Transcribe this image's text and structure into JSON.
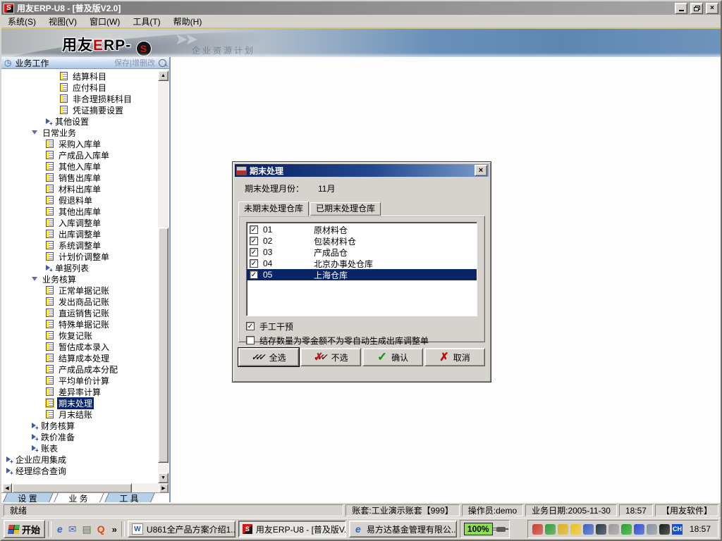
{
  "colors": {
    "selection": "#0a246a",
    "chrome": "#d6d3ce",
    "dialog_title_start": "#081f5e",
    "dialog_title_end": "#7c9dca",
    "brand_red": "#cc0000",
    "battery_green": "#8ce04c"
  },
  "window": {
    "title": "用友ERP-U8 - [普及版V2.0]",
    "logo_letter": "S"
  },
  "menu": {
    "items": [
      "系统(S)",
      "视图(V)",
      "窗口(W)",
      "工具(T)",
      "帮助(H)"
    ]
  },
  "banner": {
    "logo": {
      "brand": "用友",
      "e": "E",
      "rp": "RP",
      "dash": "-",
      "u8": "S"
    },
    "watermark": "企业资源计划"
  },
  "sidebar": {
    "header": {
      "title": "业务工作",
      "actions": "保存|增删改"
    },
    "tree": [
      {
        "label": "结算科目",
        "level": 3,
        "icon": "doc"
      },
      {
        "label": "应付科目",
        "level": 3,
        "icon": "doc"
      },
      {
        "label": "非合理损耗科目",
        "level": 3,
        "icon": "doc"
      },
      {
        "label": "凭证摘要设置",
        "level": 3,
        "icon": "doc"
      },
      {
        "label": "其他设置",
        "level": 2,
        "icon": "collapsed"
      },
      {
        "label": "日常业务",
        "level": 1,
        "icon": "expanded"
      },
      {
        "label": "采购入库单",
        "level": 2,
        "icon": "doc"
      },
      {
        "label": "产成品入库单",
        "level": 2,
        "icon": "doc"
      },
      {
        "label": "其他入库单",
        "level": 2,
        "icon": "doc"
      },
      {
        "label": "销售出库单",
        "level": 2,
        "icon": "doc"
      },
      {
        "label": "材料出库单",
        "level": 2,
        "icon": "doc"
      },
      {
        "label": "假退料单",
        "level": 2,
        "icon": "doc"
      },
      {
        "label": "其他出库单",
        "level": 2,
        "icon": "doc"
      },
      {
        "label": "入库调整单",
        "level": 2,
        "icon": "doc"
      },
      {
        "label": "出库调整单",
        "level": 2,
        "icon": "doc"
      },
      {
        "label": "系统调整单",
        "level": 2,
        "icon": "doc"
      },
      {
        "label": "计划价调整单",
        "level": 2,
        "icon": "doc"
      },
      {
        "label": "单据列表",
        "level": 2,
        "icon": "collapsed"
      },
      {
        "label": "业务核算",
        "level": 1,
        "icon": "expanded"
      },
      {
        "label": "正常单据记账",
        "level": 2,
        "icon": "doc"
      },
      {
        "label": "发出商品记账",
        "level": 2,
        "icon": "doc"
      },
      {
        "label": "直运销售记账",
        "level": 2,
        "icon": "doc"
      },
      {
        "label": "特殊单据记账",
        "level": 2,
        "icon": "doc"
      },
      {
        "label": "恢复记账",
        "level": 2,
        "icon": "doc"
      },
      {
        "label": "暂估成本录入",
        "level": 2,
        "icon": "doc"
      },
      {
        "label": "结算成本处理",
        "level": 2,
        "icon": "doc"
      },
      {
        "label": "产成品成本分配",
        "level": 2,
        "icon": "doc"
      },
      {
        "label": "平均单价计算",
        "level": 2,
        "icon": "doc"
      },
      {
        "label": "差异率计算",
        "level": 2,
        "icon": "doc"
      },
      {
        "label": "期末处理",
        "level": 2,
        "icon": "doc",
        "selected": true
      },
      {
        "label": "月末结账",
        "level": 2,
        "icon": "doc"
      },
      {
        "label": "财务核算",
        "level": 1,
        "icon": "collapsed"
      },
      {
        "label": "跌价准备",
        "level": 1,
        "icon": "collapsed"
      },
      {
        "label": "账表",
        "level": 1,
        "icon": "collapsed"
      },
      {
        "label": "企业应用集成",
        "level": 0,
        "icon": "collapsed"
      },
      {
        "label": "经理综合查询",
        "level": 0,
        "icon": "collapsed"
      }
    ],
    "tabs": {
      "items": [
        "设 置",
        "业 务",
        "工 具"
      ],
      "active": 1
    }
  },
  "dialog": {
    "title": "期末处理",
    "close": "×",
    "month": {
      "label": "期末处理月份：",
      "value": "11月"
    },
    "tabs": {
      "items": [
        "未期末处理仓库",
        "已期末处理仓库"
      ],
      "active": 0
    },
    "list": {
      "rows": [
        {
          "checked": true,
          "code": "01",
          "name": "原材料仓",
          "selected": false
        },
        {
          "checked": true,
          "code": "02",
          "name": "包装材料仓",
          "selected": false
        },
        {
          "checked": true,
          "code": "03",
          "name": "产成品仓",
          "selected": false
        },
        {
          "checked": true,
          "code": "04",
          "name": "北京办事处仓库",
          "selected": false
        },
        {
          "checked": true,
          "code": "05",
          "name": "上海仓库",
          "selected": true
        }
      ]
    },
    "options": [
      {
        "checked": true,
        "label": "手工干预"
      },
      {
        "checked": false,
        "label": "结存数量为零金额不为零自动生成出库调整单"
      }
    ],
    "buttons": [
      {
        "icon": "check-all-icon",
        "label": "全选",
        "default": true
      },
      {
        "icon": "uncheck-all-icon",
        "label": "不选",
        "default": false
      },
      {
        "icon": "confirm-icon",
        "label": "确认",
        "default": false
      },
      {
        "icon": "cancel-icon",
        "label": "取消",
        "default": false
      }
    ]
  },
  "statusbar": {
    "ready": "就绪",
    "panels": [
      "账套:工业演示账套【999】",
      "操作员:demo",
      "业务日期:2005-11-30",
      "18:57",
      "【用友软件】"
    ]
  },
  "taskbar": {
    "start": "开始",
    "quick_launch": [
      {
        "name": "ie-icon",
        "glyph": "e",
        "cls": "ie"
      },
      {
        "name": "outlook-express-icon",
        "glyph": "✉",
        "cls": "mail"
      },
      {
        "name": "desktop-icon",
        "glyph": "▤",
        "cls": "desk"
      },
      {
        "name": "qq-browser-icon",
        "glyph": "Q",
        "cls": "qq"
      }
    ],
    "more": "»",
    "tasks": [
      {
        "icon": "word",
        "glyph": "W",
        "label": "U861全产品方案介绍1...",
        "active": false
      },
      {
        "icon": "ufida",
        "glyph": "S",
        "label": "用友ERP-U8 - [普及版V...",
        "active": true
      },
      {
        "icon": "ie",
        "glyph": "e",
        "label": "易方达基金管理有限公...",
        "active": false
      }
    ],
    "battery": "100%",
    "tray": [
      {
        "name": "network-activity-icon",
        "color": "#c84030"
      },
      {
        "name": "pen-input-icon",
        "color": "#3a9a3a"
      },
      {
        "name": "volume-icon",
        "color": "#d8b020"
      },
      {
        "name": "qq-pet-icon",
        "color": "#e8c020"
      },
      {
        "name": "network-places-icon",
        "color": "#4060c0"
      },
      {
        "name": "display-icon",
        "color": "#283848"
      },
      {
        "name": "mobile-device-icon",
        "color": "#989898"
      },
      {
        "name": "antivirus-icon",
        "color": "#28a028"
      },
      {
        "name": "messenger-icon",
        "color": "#3050d0"
      },
      {
        "name": "database-service-icon",
        "color": "#8890a0"
      },
      {
        "name": "qq-penguin-icon",
        "color": "#1a1a1a"
      }
    ],
    "lang": "CH",
    "lang_color": "#1a50c8",
    "time": "18:57"
  }
}
